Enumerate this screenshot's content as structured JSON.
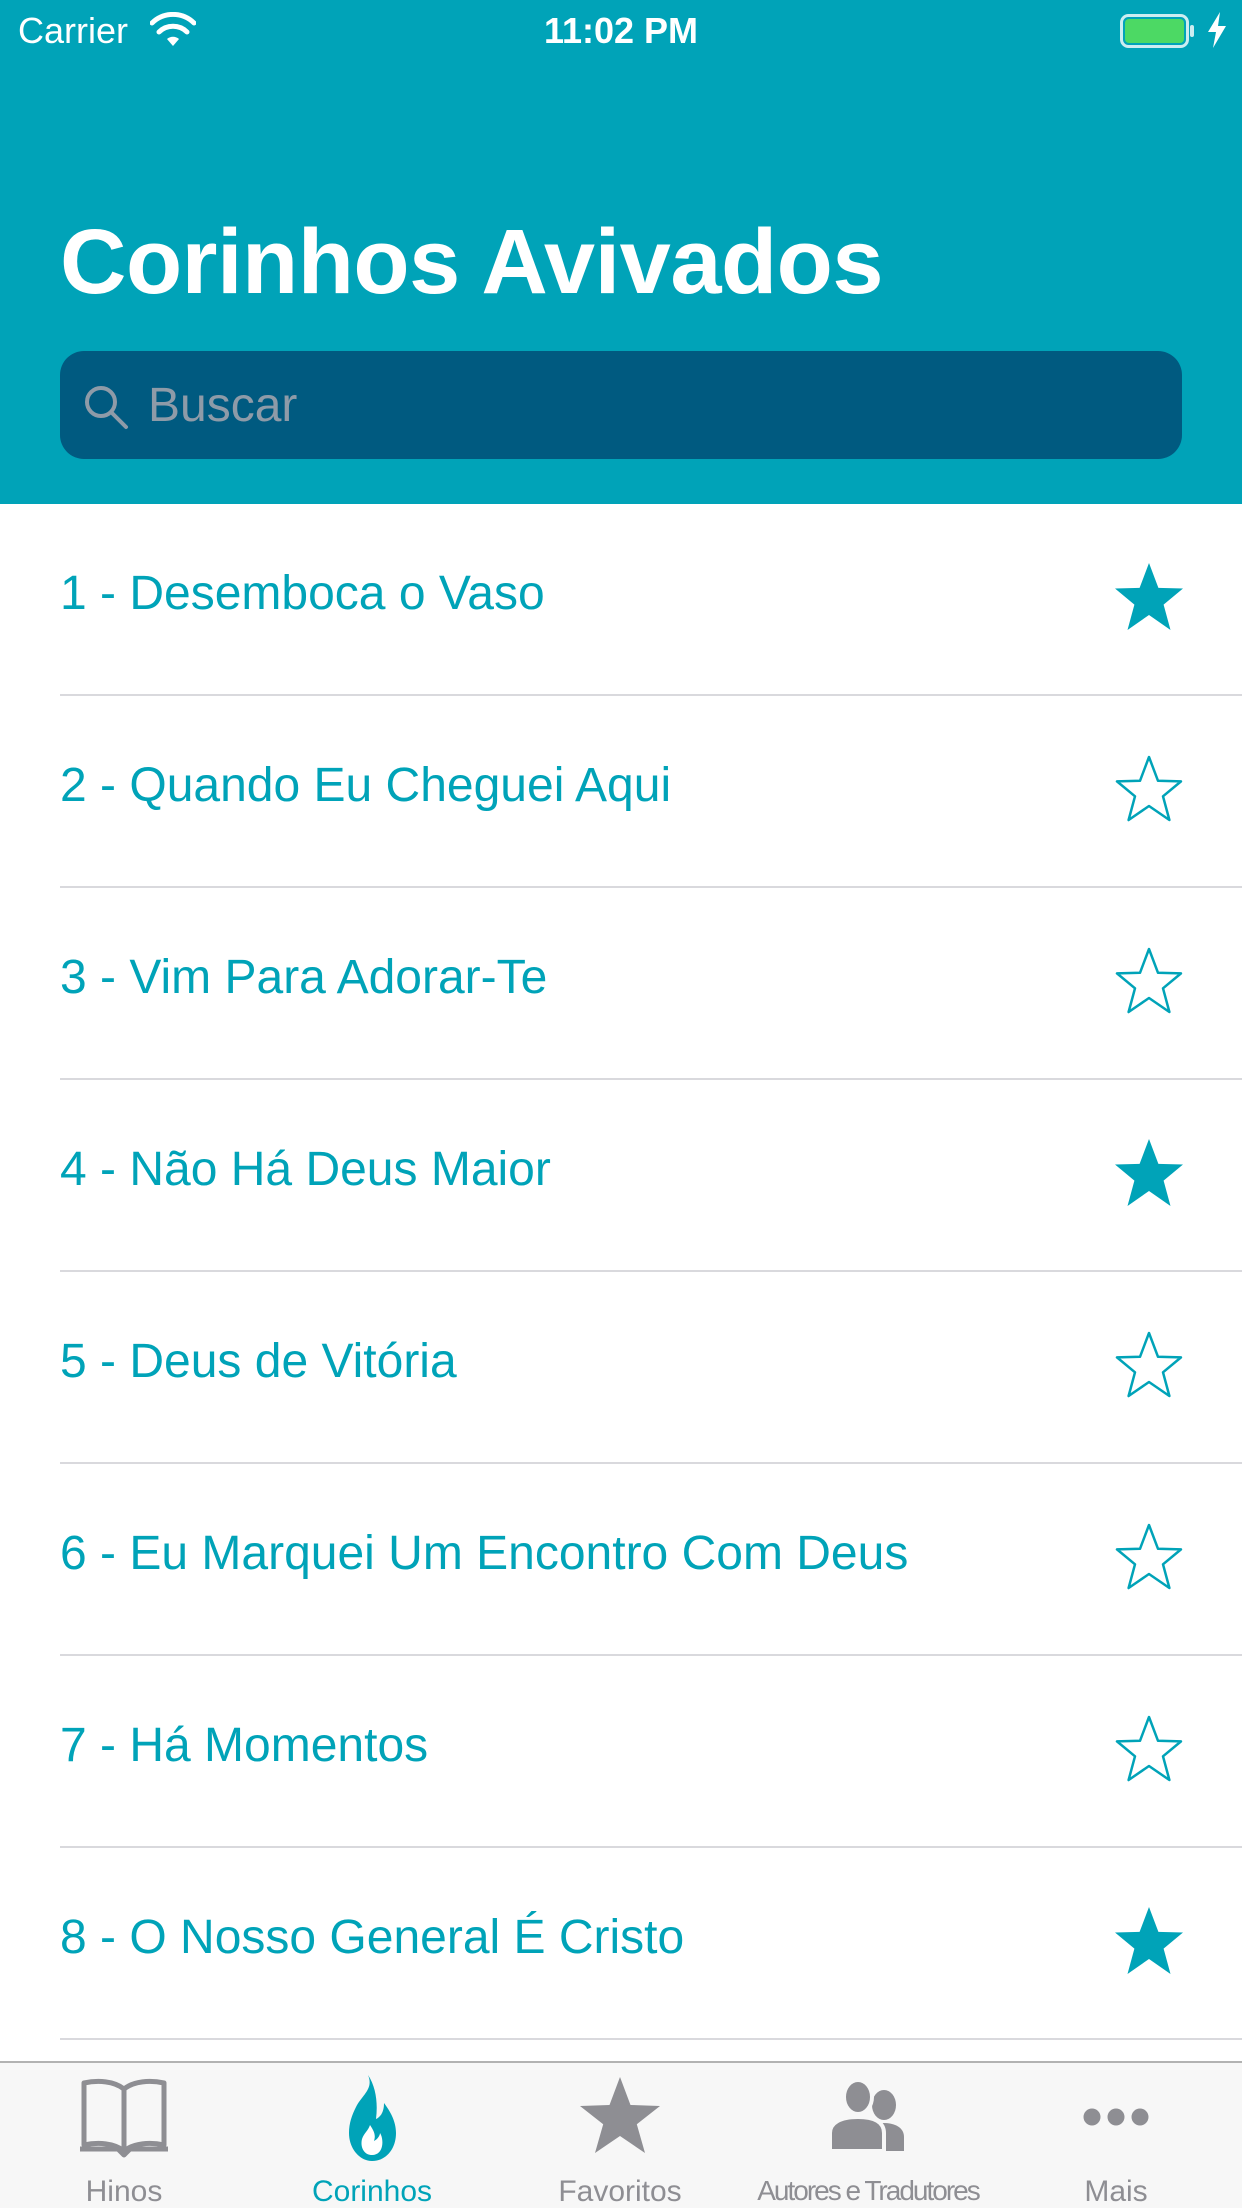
{
  "status_bar": {
    "carrier": "Carrier",
    "time": "11:02 PM",
    "battery_color": "#4cd964"
  },
  "header": {
    "title": "Corinhos Avivados",
    "background": "#00a3b8"
  },
  "search": {
    "placeholder": "Buscar",
    "value": ""
  },
  "list": {
    "items": [
      {
        "label": "1 - Desemboca o Vaso",
        "favorite": true
      },
      {
        "label": "2 - Quando Eu Cheguei Aqui",
        "favorite": false
      },
      {
        "label": "3 - Vim Para Adorar-Te",
        "favorite": false
      },
      {
        "label": "4 - Não Há Deus Maior",
        "favorite": true
      },
      {
        "label": "5 - Deus de Vitória",
        "favorite": false
      },
      {
        "label": "6 - Eu Marquei Um Encontro Com Deus",
        "favorite": false
      },
      {
        "label": "7 - Há Momentos",
        "favorite": false
      },
      {
        "label": "8 - O Nosso General É Cristo",
        "favorite": true
      }
    ]
  },
  "tab_bar": {
    "tabs": [
      {
        "label": "Hinos",
        "icon": "book-icon",
        "active": false
      },
      {
        "label": "Corinhos",
        "icon": "flame-icon",
        "active": true
      },
      {
        "label": "Favoritos",
        "icon": "star-icon",
        "active": false
      },
      {
        "label": "Autores e Tradutores",
        "icon": "people-icon",
        "active": false
      },
      {
        "label": "Mais",
        "icon": "more-icon",
        "active": false
      }
    ]
  },
  "colors": {
    "accent": "#00a3b8",
    "search_background": "#005a80",
    "inactive_tab": "#8e8e93"
  }
}
